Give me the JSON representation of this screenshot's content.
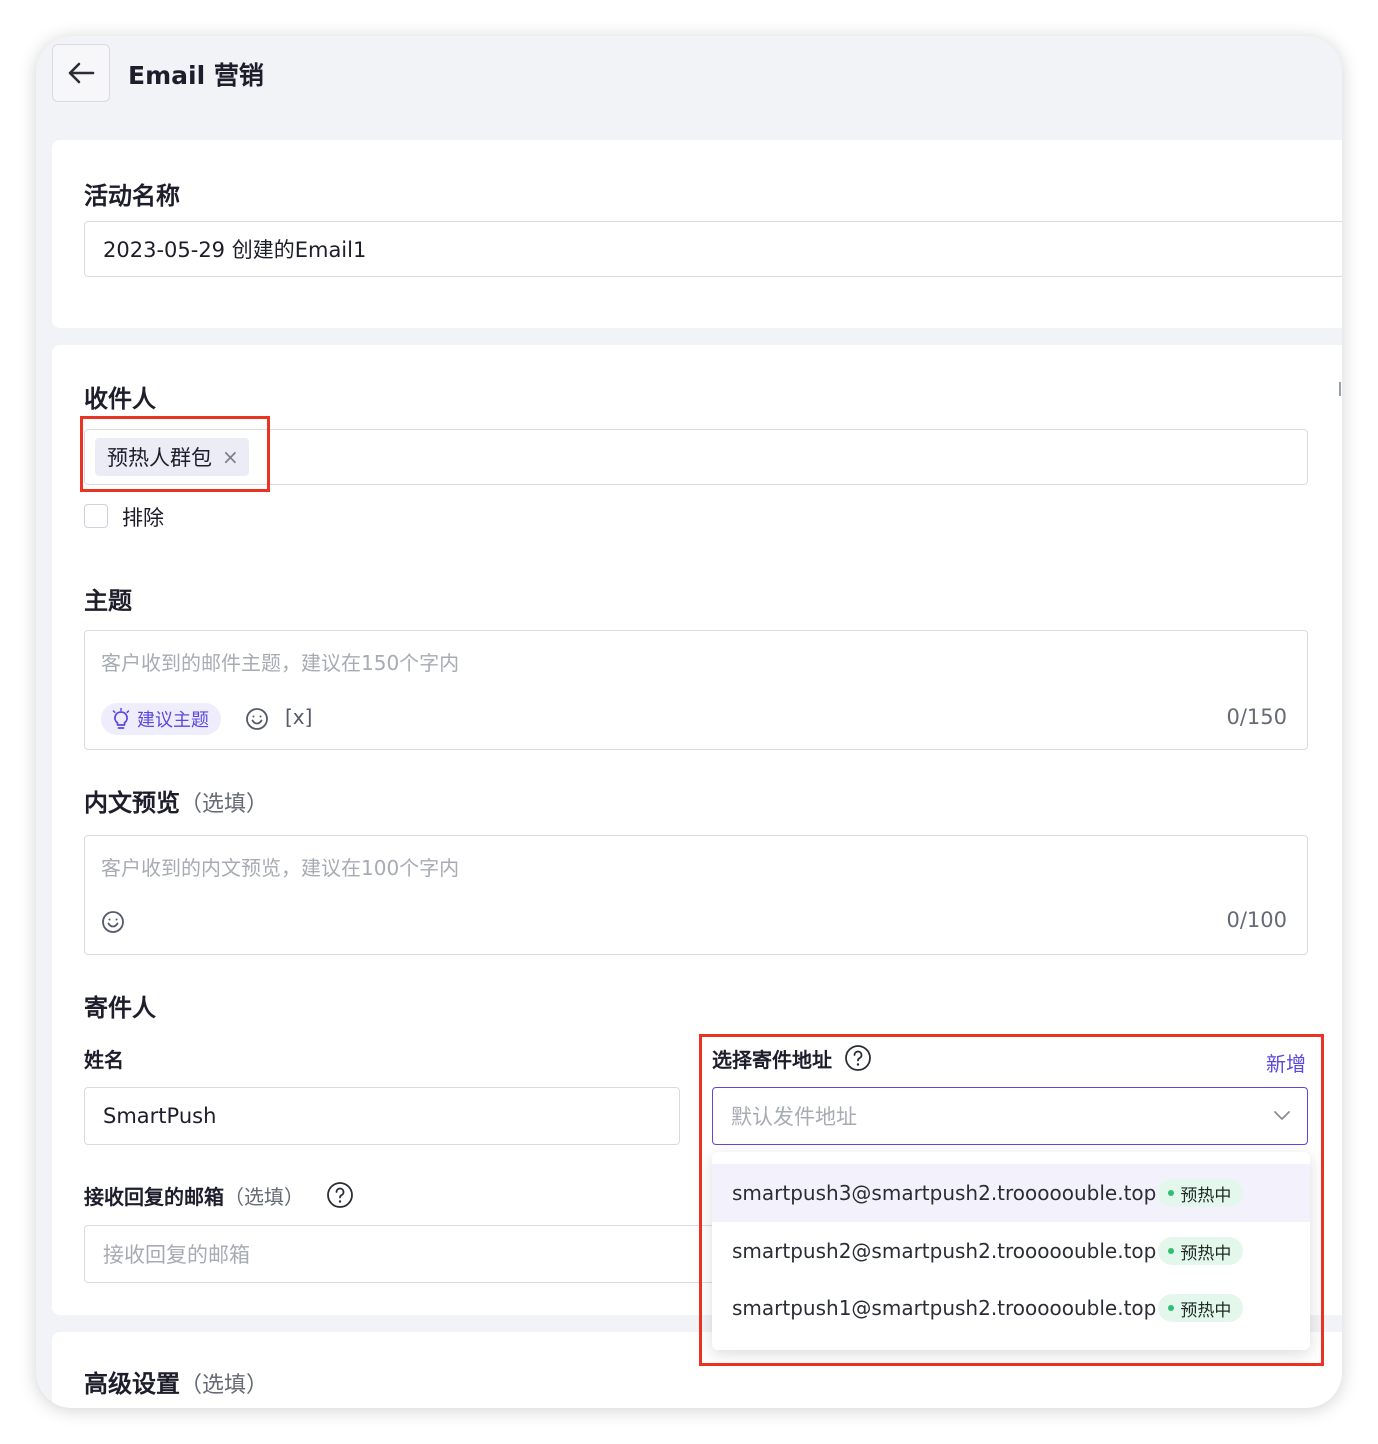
{
  "header": {
    "title": "Email 营销"
  },
  "campaign": {
    "label": "活动名称",
    "value": "2023-05-29 创建的Email1"
  },
  "recipients": {
    "label": "收件人",
    "tag": "预热人群包",
    "tag_close": "×",
    "exclude_label": "排除"
  },
  "subject": {
    "label": "主题",
    "placeholder": "客户收到的邮件主题，建议在150个字内",
    "suggest_label": "建议主题",
    "variable_label": "[x]",
    "counter": "0/150"
  },
  "preview": {
    "label": "内文预览",
    "optional": "（选填）",
    "placeholder": "客户收到的内文预览，建议在100个字内",
    "counter": "0/100"
  },
  "sender": {
    "label": "寄件人",
    "name_label": "姓名",
    "name_value": "SmartPush",
    "address_label": "选择寄件地址",
    "new_link": "新增",
    "address_placeholder": "默认发件地址",
    "reply_label": "接收回复的邮箱",
    "reply_optional": "（选填）",
    "reply_placeholder": "接收回复的邮箱"
  },
  "address_options": [
    {
      "email": "smartpush3@smartpush2.trooooouble.top",
      "status": "预热中"
    },
    {
      "email": "smartpush2@smartpush2.trooooouble.top",
      "status": "预热中"
    },
    {
      "email": "smartpush1@smartpush2.trooooouble.top",
      "status": "预热中"
    }
  ],
  "advanced": {
    "label": "高级设置",
    "optional": "（选填）"
  },
  "colors": {
    "accent": "#5b48e0",
    "highlight": "#ea3323",
    "warm_badge_bg": "#e4f7ec",
    "warm_dot": "#2fbf71"
  }
}
